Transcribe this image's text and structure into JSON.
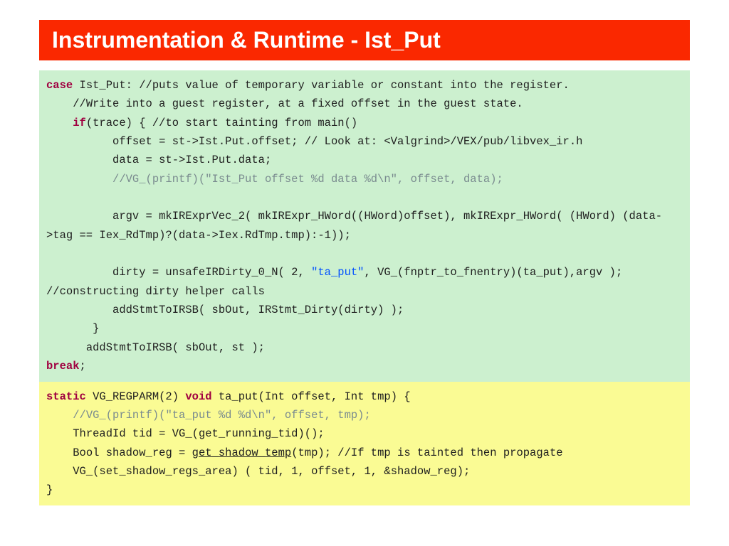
{
  "title": "Instrumentation & Runtime - Ist_Put",
  "code_top": {
    "kw_case": "case",
    "s1": " Ist_Put: //puts value of temporary variable or constant into the register.",
    "s2": "    //Write into a guest register, at a fixed offset in the guest state.",
    "kw_if": "    if",
    "s3": "(trace) { //to start tainting from main()",
    "s4": "          offset = st->Ist.Put.offset; // Look at: <Valgrind>/VEX/pub/libvex_ir.h",
    "s5": "          data = st->Ist.Put.data;",
    "cm1": "          //VG_(printf)(\"Ist_Put offset %d data %d\\n\", offset, data);",
    "s6": "          argv = mkIRExprVec_2( mkIRExpr_HWord((HWord)offset), mkIRExpr_HWord( (HWord) (data->tag == Iex_RdTmp)?(data->Iex.RdTmp.tmp):-1));",
    "s7a": "          dirty = unsafeIRDirty_0_N( 2, ",
    "str1": "\"ta_put\"",
    "s7b": ", VG_(fnptr_to_fnentry)(ta_put),argv ); //constructing dirty helper calls",
    "s8": "          addStmtToIRSB( sbOut, IRStmt_Dirty(dirty) );",
    "s9": "       }",
    "s10": "      addStmtToIRSB( sbOut, st );",
    "kw_break": "break",
    "s11": ";"
  },
  "code_bottom": {
    "kw_static": "static",
    "b1": " VG_REGPARM(2) ",
    "kw_void": "void",
    "b2": " ta_put(Int offset, Int tmp) {",
    "cm2": "    //VG_(printf)(\"ta_put %d %d\\n\", offset, tmp);",
    "b3": "    ThreadId tid = VG_(get_running_tid)();",
    "b4a": "    Bool shadow_reg = ",
    "b4u": "get_shadow_temp",
    "b4b": "(tmp); //If tmp is tainted then propagate",
    "b5": "    VG_(set_shadow_regs_area) ( tid, 1, offset, 1, &shadow_reg);",
    "b6": "}"
  }
}
